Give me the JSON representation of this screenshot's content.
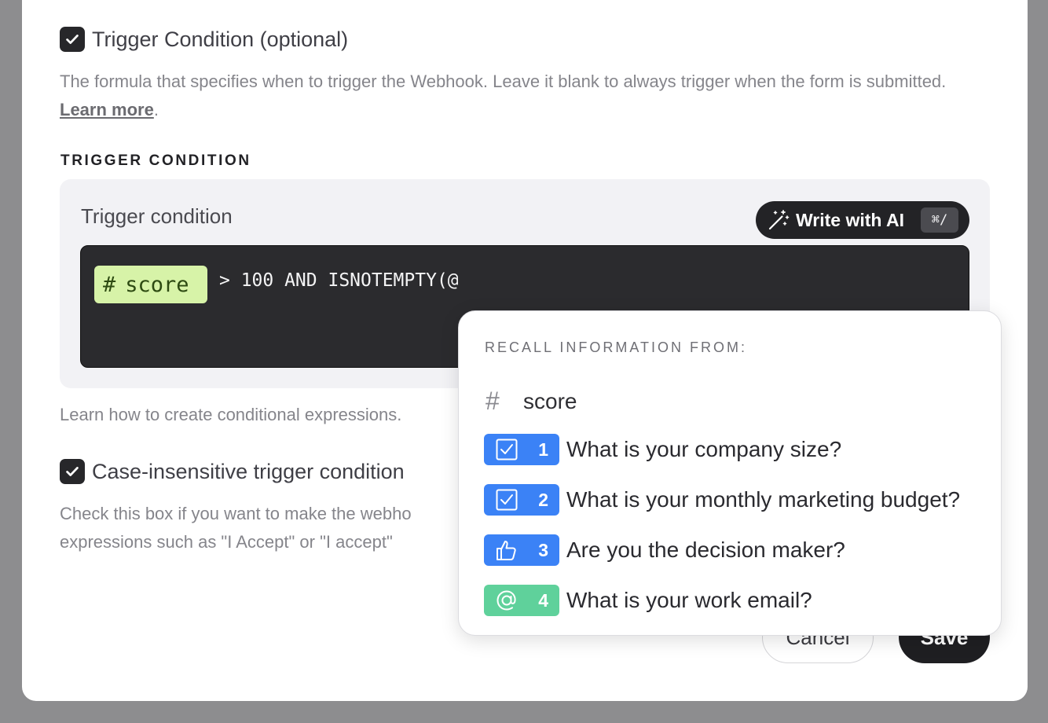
{
  "trigger_option": {
    "checked": true,
    "label": "Trigger Condition (optional)",
    "help_text": "The formula that specifies when to trigger the Webhook. Leave it blank to always trigger when the form is submitted.",
    "learn_more": "Learn more",
    "period": "."
  },
  "section_title": "TRIGGER CONDITION",
  "condition_box": {
    "label": "Trigger condition",
    "ai_button_label": "Write with AI",
    "ai_shortcut": "⌘/",
    "pill_hash": "#",
    "pill_variable": "score",
    "code_text": "> 100 AND ISNOTEMPTY(@"
  },
  "conditional_help": "Learn how to create conditional expressions.",
  "case_option": {
    "checked": true,
    "label": "Case-insensitive trigger condition",
    "help_line1": "Check this box if you want to make the webho",
    "help_line2": "expressions such as \"I Accept\" or \"I accept\""
  },
  "buttons": {
    "cancel": "Cancel",
    "save": "Save"
  },
  "recall_popup": {
    "title": "RECALL INFORMATION FROM:",
    "variable_hash": "#",
    "variable_name": "score",
    "questions": [
      {
        "number": "1",
        "icon": "checkbox-icon",
        "color": "#3b82f6",
        "text": "What is your company size?"
      },
      {
        "number": "2",
        "icon": "checkbox-icon",
        "color": "#3b82f6",
        "text": "What is your monthly marketing budget?"
      },
      {
        "number": "3",
        "icon": "thumbs-up-icon",
        "color": "#3b82f6",
        "text": "Are you the decision maker?"
      },
      {
        "number": "4",
        "icon": "at-sign-icon",
        "color": "#5fd19b",
        "text": "What is your work email?"
      }
    ]
  }
}
